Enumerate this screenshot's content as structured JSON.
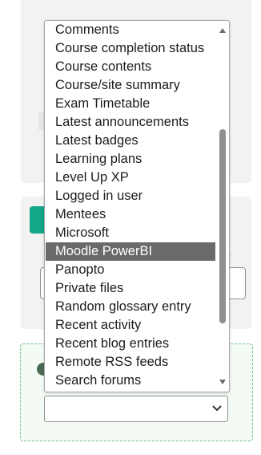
{
  "dropdown": {
    "items": [
      "Comments",
      "Course completion status",
      "Course contents",
      "Course/site summary",
      "Exam Timetable",
      "Latest announcements",
      "Latest badges",
      "Learning plans",
      "Level Up XP",
      "Logged in user",
      "Mentees",
      "Microsoft",
      "Moodle PowerBI",
      "Panopto",
      "Private files",
      "Random glossary entry",
      "Recent activity",
      "Recent blog entries",
      "Remote RSS feeds",
      "Search forums"
    ],
    "selected": "Moodle PowerBI"
  },
  "colors": {
    "selected_bg": "#6a6a6a",
    "accent_green": "#13a689",
    "dashed_border": "#78c28b"
  },
  "icons": {
    "block_badge": "move-icon",
    "add_block": "add-circle-icon",
    "select_caret": "chevron-down-icon"
  }
}
